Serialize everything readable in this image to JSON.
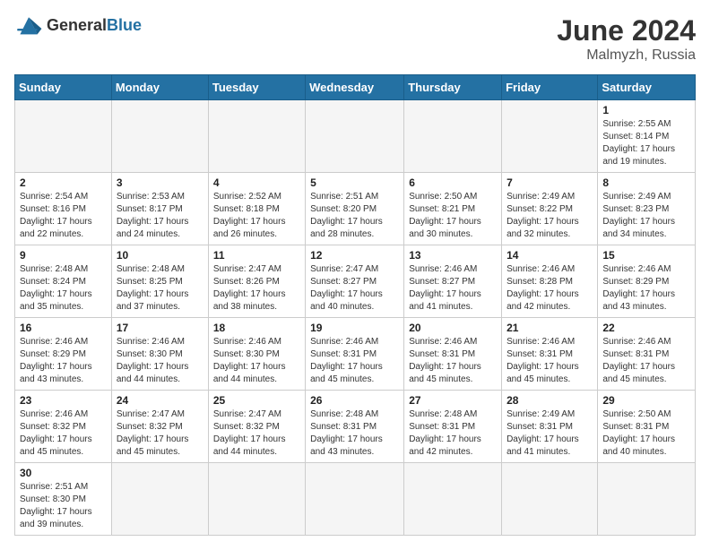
{
  "header": {
    "logo_general": "General",
    "logo_blue": "Blue",
    "title": "June 2024",
    "location": "Malmyzh, Russia"
  },
  "weekdays": [
    "Sunday",
    "Monday",
    "Tuesday",
    "Wednesday",
    "Thursday",
    "Friday",
    "Saturday"
  ],
  "weeks": [
    [
      {
        "day": "",
        "info": ""
      },
      {
        "day": "",
        "info": ""
      },
      {
        "day": "",
        "info": ""
      },
      {
        "day": "",
        "info": ""
      },
      {
        "day": "",
        "info": ""
      },
      {
        "day": "",
        "info": ""
      },
      {
        "day": "1",
        "info": "Sunrise: 2:55 AM\nSunset: 8:14 PM\nDaylight: 17 hours\nand 19 minutes."
      }
    ],
    [
      {
        "day": "2",
        "info": "Sunrise: 2:54 AM\nSunset: 8:16 PM\nDaylight: 17 hours\nand 22 minutes."
      },
      {
        "day": "3",
        "info": "Sunrise: 2:53 AM\nSunset: 8:17 PM\nDaylight: 17 hours\nand 24 minutes."
      },
      {
        "day": "4",
        "info": "Sunrise: 2:52 AM\nSunset: 8:18 PM\nDaylight: 17 hours\nand 26 minutes."
      },
      {
        "day": "5",
        "info": "Sunrise: 2:51 AM\nSunset: 8:20 PM\nDaylight: 17 hours\nand 28 minutes."
      },
      {
        "day": "6",
        "info": "Sunrise: 2:50 AM\nSunset: 8:21 PM\nDaylight: 17 hours\nand 30 minutes."
      },
      {
        "day": "7",
        "info": "Sunrise: 2:49 AM\nSunset: 8:22 PM\nDaylight: 17 hours\nand 32 minutes."
      },
      {
        "day": "8",
        "info": "Sunrise: 2:49 AM\nSunset: 8:23 PM\nDaylight: 17 hours\nand 34 minutes."
      }
    ],
    [
      {
        "day": "9",
        "info": "Sunrise: 2:48 AM\nSunset: 8:24 PM\nDaylight: 17 hours\nand 35 minutes."
      },
      {
        "day": "10",
        "info": "Sunrise: 2:48 AM\nSunset: 8:25 PM\nDaylight: 17 hours\nand 37 minutes."
      },
      {
        "day": "11",
        "info": "Sunrise: 2:47 AM\nSunset: 8:26 PM\nDaylight: 17 hours\nand 38 minutes."
      },
      {
        "day": "12",
        "info": "Sunrise: 2:47 AM\nSunset: 8:27 PM\nDaylight: 17 hours\nand 40 minutes."
      },
      {
        "day": "13",
        "info": "Sunrise: 2:46 AM\nSunset: 8:27 PM\nDaylight: 17 hours\nand 41 minutes."
      },
      {
        "day": "14",
        "info": "Sunrise: 2:46 AM\nSunset: 8:28 PM\nDaylight: 17 hours\nand 42 minutes."
      },
      {
        "day": "15",
        "info": "Sunrise: 2:46 AM\nSunset: 8:29 PM\nDaylight: 17 hours\nand 43 minutes."
      }
    ],
    [
      {
        "day": "16",
        "info": "Sunrise: 2:46 AM\nSunset: 8:29 PM\nDaylight: 17 hours\nand 43 minutes."
      },
      {
        "day": "17",
        "info": "Sunrise: 2:46 AM\nSunset: 8:30 PM\nDaylight: 17 hours\nand 44 minutes."
      },
      {
        "day": "18",
        "info": "Sunrise: 2:46 AM\nSunset: 8:30 PM\nDaylight: 17 hours\nand 44 minutes."
      },
      {
        "day": "19",
        "info": "Sunrise: 2:46 AM\nSunset: 8:31 PM\nDaylight: 17 hours\nand 45 minutes."
      },
      {
        "day": "20",
        "info": "Sunrise: 2:46 AM\nSunset: 8:31 PM\nDaylight: 17 hours\nand 45 minutes."
      },
      {
        "day": "21",
        "info": "Sunrise: 2:46 AM\nSunset: 8:31 PM\nDaylight: 17 hours\nand 45 minutes."
      },
      {
        "day": "22",
        "info": "Sunrise: 2:46 AM\nSunset: 8:31 PM\nDaylight: 17 hours\nand 45 minutes."
      }
    ],
    [
      {
        "day": "23",
        "info": "Sunrise: 2:46 AM\nSunset: 8:32 PM\nDaylight: 17 hours\nand 45 minutes."
      },
      {
        "day": "24",
        "info": "Sunrise: 2:47 AM\nSunset: 8:32 PM\nDaylight: 17 hours\nand 45 minutes."
      },
      {
        "day": "25",
        "info": "Sunrise: 2:47 AM\nSunset: 8:32 PM\nDaylight: 17 hours\nand 44 minutes."
      },
      {
        "day": "26",
        "info": "Sunrise: 2:48 AM\nSunset: 8:31 PM\nDaylight: 17 hours\nand 43 minutes."
      },
      {
        "day": "27",
        "info": "Sunrise: 2:48 AM\nSunset: 8:31 PM\nDaylight: 17 hours\nand 42 minutes."
      },
      {
        "day": "28",
        "info": "Sunrise: 2:49 AM\nSunset: 8:31 PM\nDaylight: 17 hours\nand 41 minutes."
      },
      {
        "day": "29",
        "info": "Sunrise: 2:50 AM\nSunset: 8:31 PM\nDaylight: 17 hours\nand 40 minutes."
      }
    ],
    [
      {
        "day": "30",
        "info": "Sunrise: 2:51 AM\nSunset: 8:30 PM\nDaylight: 17 hours\nand 39 minutes."
      },
      {
        "day": "",
        "info": ""
      },
      {
        "day": "",
        "info": ""
      },
      {
        "day": "",
        "info": ""
      },
      {
        "day": "",
        "info": ""
      },
      {
        "day": "",
        "info": ""
      },
      {
        "day": "",
        "info": ""
      }
    ]
  ]
}
